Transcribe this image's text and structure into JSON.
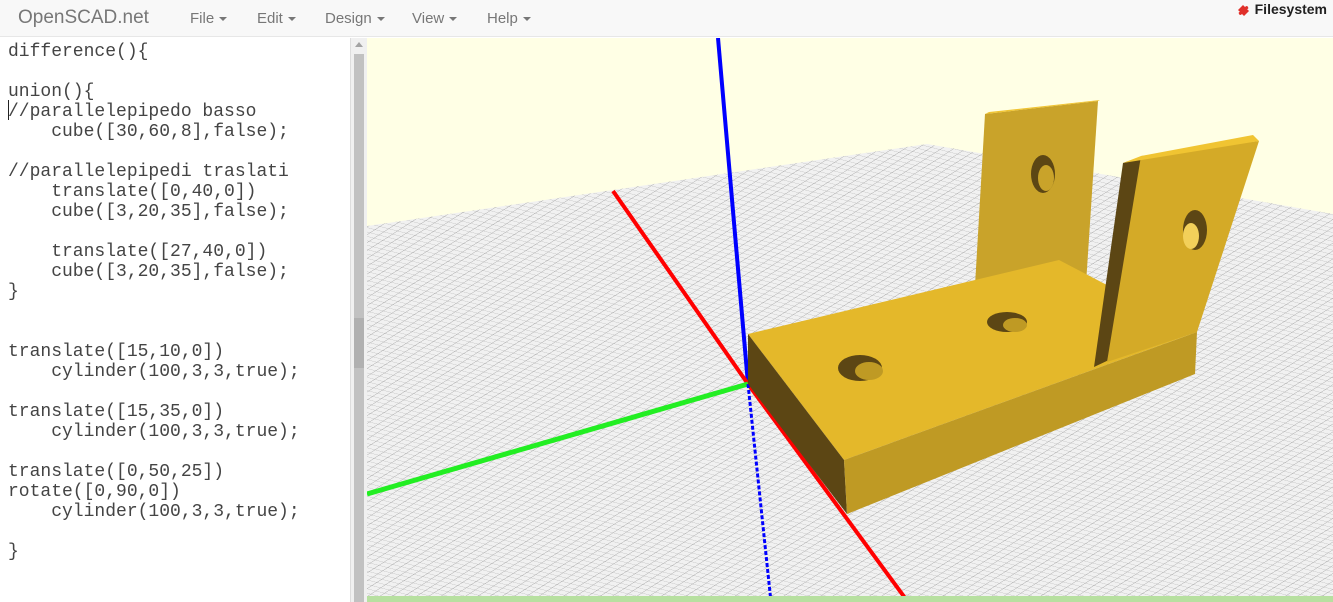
{
  "navbar": {
    "brand": "OpenSCAD.net",
    "menus": [
      {
        "label": "File"
      },
      {
        "label": "Edit"
      },
      {
        "label": "Design"
      },
      {
        "label": "View"
      },
      {
        "label": "Help"
      }
    ],
    "filesystem": {
      "label": "Filesystem",
      "icon": "puzzle-icon"
    }
  },
  "editor": {
    "lines": [
      "difference(){",
      "",
      "union(){",
      "//parallelepipedo basso",
      "    cube([30,60,8],false);",
      "",
      "//parallelepipedi traslati",
      "    translate([0,40,0])",
      "    cube([3,20,35],false);",
      "",
      "    translate([27,40,0])",
      "    cube([3,20,35],false);",
      "}",
      "",
      "",
      "translate([15,10,0])",
      "    cylinder(100,3,3,true);",
      "",
      "translate([15,35,0])",
      "    cylinder(100,3,3,true);",
      "",
      "translate([0,50,25])",
      "rotate([0,90,0])",
      "    cylinder(100,3,3,true);",
      "",
      "}"
    ]
  },
  "viewport": {
    "background": "#ffffe5",
    "model_color": "#e4b82a",
    "axis_colors": {
      "x": "#ff0000",
      "y": "#00dd00",
      "z": "#0000ff"
    }
  }
}
